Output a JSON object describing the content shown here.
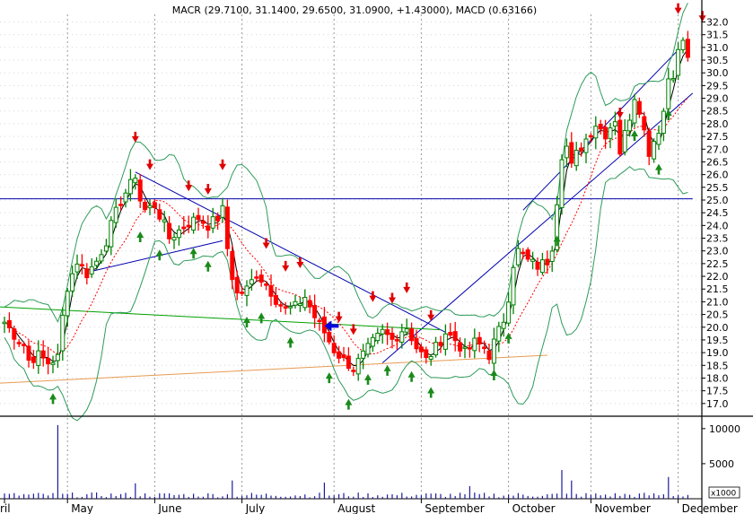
{
  "header": {
    "title": "MACR (29.7100, 31.1400, 29.6500, 31.0900, +1.43000), MACD (0.63166)"
  },
  "chart_data": {
    "type": "candlestick",
    "title": "MACR (29.7100, 31.1400, 29.6500, 31.0900, +1.43000), MACD (0.63166)",
    "price_axis": {
      "ylim": [
        16.5,
        32.3
      ],
      "ticks": [
        17.0,
        17.5,
        18.0,
        18.5,
        19.0,
        19.5,
        20.0,
        20.5,
        21.0,
        21.5,
        22.0,
        22.5,
        23.0,
        23.5,
        24.0,
        24.5,
        25.0,
        25.5,
        26.0,
        26.5,
        27.0,
        27.5,
        28.0,
        28.5,
        29.0,
        29.5,
        30.0,
        30.5,
        31.0,
        31.5,
        32.0
      ]
    },
    "volume_axis": {
      "ylim": [
        0,
        11000
      ],
      "ticks": [
        {
          "value": 5000,
          "label": "5000"
        },
        {
          "value": 10000,
          "label": "10000"
        }
      ],
      "unit_label": "x1000"
    },
    "x_axis": {
      "days": 142,
      "month_labels": [
        {
          "label": "ril",
          "day": 0
        },
        {
          "label": "May",
          "day": 13
        },
        {
          "label": "June",
          "day": 31
        },
        {
          "label": "July",
          "day": 49
        },
        {
          "label": "August",
          "day": 68
        },
        {
          "label": "September",
          "day": 86
        },
        {
          "label": "October",
          "day": 104
        },
        {
          "label": "November",
          "day": 121
        },
        {
          "label": "December",
          "day": 139
        }
      ],
      "gridline_days": [
        13,
        31,
        49,
        68,
        86,
        104,
        121,
        139
      ]
    },
    "anchors": [
      [
        0,
        20.2
      ],
      [
        2,
        19.7
      ],
      [
        4,
        19.3
      ],
      [
        5,
        18.7
      ],
      [
        7,
        18.9
      ],
      [
        9,
        18.6
      ],
      [
        11,
        18.8
      ],
      [
        12,
        20.4
      ],
      [
        13,
        21.6
      ],
      [
        15,
        22.6
      ],
      [
        17,
        22.1
      ],
      [
        19,
        22.6
      ],
      [
        21,
        23.4
      ],
      [
        22,
        24.0
      ],
      [
        24,
        25.0
      ],
      [
        26,
        25.6
      ],
      [
        27,
        26.0
      ],
      [
        28,
        25.0
      ],
      [
        29,
        24.6
      ],
      [
        31,
        24.8
      ],
      [
        33,
        24.0
      ],
      [
        34,
        23.5
      ],
      [
        36,
        23.8
      ],
      [
        38,
        24.1
      ],
      [
        40,
        24.3
      ],
      [
        42,
        24.0
      ],
      [
        44,
        24.3
      ],
      [
        45,
        24.6
      ],
      [
        46,
        23.1
      ],
      [
        47,
        22.0
      ],
      [
        48,
        21.3
      ],
      [
        50,
        21.5
      ],
      [
        52,
        22.1
      ],
      [
        54,
        21.7
      ],
      [
        56,
        21.1
      ],
      [
        58,
        20.7
      ],
      [
        60,
        20.8
      ],
      [
        62,
        21.2
      ],
      [
        64,
        20.4
      ],
      [
        66,
        19.8
      ],
      [
        68,
        19.1
      ],
      [
        70,
        18.7
      ],
      [
        72,
        18.4
      ],
      [
        74,
        18.9
      ],
      [
        76,
        19.4
      ],
      [
        78,
        19.8
      ],
      [
        80,
        19.5
      ],
      [
        82,
        19.9
      ],
      [
        83,
        20.0
      ],
      [
        85,
        19.2
      ],
      [
        87,
        18.7
      ],
      [
        89,
        19.2
      ],
      [
        91,
        19.8
      ],
      [
        93,
        19.5
      ],
      [
        95,
        19.0
      ],
      [
        97,
        19.4
      ],
      [
        99,
        19.2
      ],
      [
        100,
        18.9
      ],
      [
        101,
        19.4
      ],
      [
        103,
        20.3
      ],
      [
        104,
        21.2
      ],
      [
        105,
        22.5
      ],
      [
        106,
        23.0
      ],
      [
        108,
        22.6
      ],
      [
        110,
        22.4
      ],
      [
        112,
        22.6
      ],
      [
        113,
        23.2
      ],
      [
        114,
        25.0
      ],
      [
        115,
        26.8
      ],
      [
        116,
        27.1
      ],
      [
        117,
        26.3
      ],
      [
        118,
        26.8
      ],
      [
        120,
        27.4
      ],
      [
        122,
        28.0
      ],
      [
        124,
        27.6
      ],
      [
        126,
        28.2
      ],
      [
        127,
        26.9
      ],
      [
        129,
        28.3
      ],
      [
        130,
        29.1
      ],
      [
        131,
        28.6
      ],
      [
        132,
        27.7
      ],
      [
        133,
        26.9
      ],
      [
        135,
        27.8
      ],
      [
        136,
        28.5
      ],
      [
        137,
        29.8
      ],
      [
        138,
        30.0
      ],
      [
        139,
        30.8
      ],
      [
        140,
        31.3
      ],
      [
        141,
        30.5
      ]
    ],
    "series": [
      {
        "name": "price bars (OHLC)",
        "color": "#008000",
        "down_color": "#ff0000"
      },
      {
        "name": "moving average",
        "color": "#000000"
      },
      {
        "name": "middle band",
        "color": "#ff0000",
        "dash": "dotted"
      },
      {
        "name": "upper band",
        "color": "#2e9b5a"
      },
      {
        "name": "lower band",
        "color": "#2e9b5a"
      }
    ],
    "volume_spikes": [
      {
        "day": 11,
        "value": 10500
      },
      {
        "day": 27,
        "value": 2200
      },
      {
        "day": 47,
        "value": 2600
      },
      {
        "day": 66,
        "value": 2300
      },
      {
        "day": 96,
        "value": 1800
      },
      {
        "day": 115,
        "value": 4100
      },
      {
        "day": 117,
        "value": 2600
      },
      {
        "day": 137,
        "value": 3100
      }
    ],
    "trendlines": [
      {
        "name": "horizontal resistance",
        "color": "#0000b0",
        "from": [
          -1,
          25.05
        ],
        "to": [
          142,
          25.05
        ]
      },
      {
        "name": "declining trendline",
        "color": "#0000b0",
        "from": [
          27,
          26.1
        ],
        "to": [
          91,
          19.8
        ]
      },
      {
        "name": "support trendline",
        "color": "#0000b0",
        "from": [
          18,
          22.2
        ],
        "to": [
          45,
          23.4
        ]
      },
      {
        "name": "rising channel top",
        "color": "#0000b0",
        "from": [
          107,
          24.6
        ],
        "to": [
          139,
          30.9
        ]
      },
      {
        "name": "rising channel bottom",
        "color": "#0000b0",
        "from": [
          78,
          18.6
        ],
        "to": [
          142,
          29.2
        ]
      },
      {
        "name": "green trendline",
        "color": "#00a000",
        "from": [
          -1,
          20.8
        ],
        "to": [
          90,
          19.9
        ]
      },
      {
        "name": "orange trendline",
        "color": "#e89a52",
        "from": [
          -1,
          17.8
        ],
        "to": [
          112,
          18.9
        ]
      }
    ],
    "annotations": {
      "sell_arrows": [
        27,
        30,
        38,
        42,
        45,
        54,
        58,
        61,
        69,
        72,
        76,
        80,
        83,
        88,
        127,
        139,
        144
      ],
      "buy_arrows": [
        10,
        28,
        32,
        39,
        42,
        50,
        53,
        59,
        67,
        71,
        75,
        79,
        84,
        88,
        101,
        104,
        114,
        130,
        135,
        137
      ],
      "blue_pointer": {
        "day": 66,
        "price": 20.05
      }
    },
    "grid": true,
    "legend": "none"
  }
}
